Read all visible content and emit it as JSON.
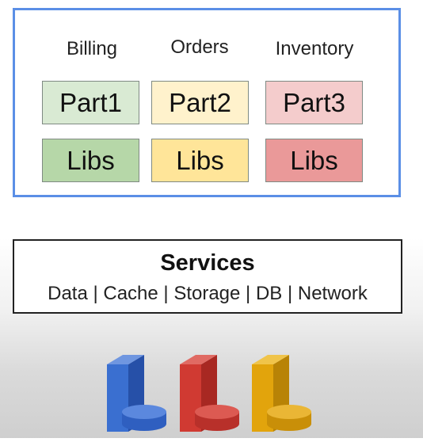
{
  "application": {
    "columns": [
      {
        "header": "Billing",
        "part": "Part1",
        "libs": "Libs",
        "part_color": "#d9ead3",
        "libs_color": "#b6d7a8"
      },
      {
        "header": "Orders",
        "part": "Part2",
        "libs": "Libs",
        "part_color": "#fff2cc",
        "libs_color": "#ffe599"
      },
      {
        "header": "Inventory",
        "part": "Part3",
        "libs": "Libs",
        "part_color": "#f4cccc",
        "libs_color": "#ea9999"
      }
    ],
    "border_color": "#5b8fe6"
  },
  "services": {
    "title": "Services",
    "items": "Data | Cache | Storage | DB | Network"
  },
  "databases": [
    {
      "color": "#3a6fd0",
      "icon": "database-icon"
    },
    {
      "color": "#d03a32",
      "icon": "database-icon"
    },
    {
      "color": "#e2a40c",
      "icon": "database-icon"
    }
  ]
}
